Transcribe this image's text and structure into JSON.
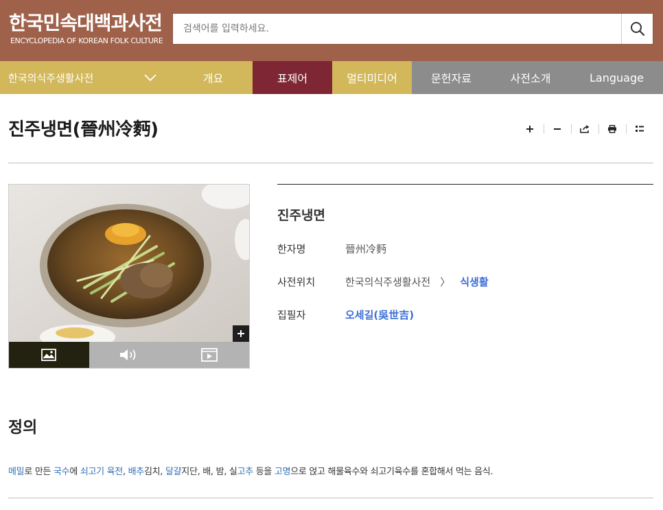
{
  "header": {
    "logo_ko": "한국민속대백과사전",
    "logo_en": "ENCYCLOPEDIA OF KOREAN FOLK CULTURE",
    "search_placeholder": "검색어를 입력하세요.",
    "search_icon": "search-icon"
  },
  "nav": {
    "dictionary": "한국의식주생활사전",
    "items": [
      "개요",
      "표제어",
      "멀티미디어",
      "문헌자료",
      "사전소개",
      "Language"
    ]
  },
  "entry": {
    "title": "진주냉면(晉州冷麪)",
    "name": "진주냉면",
    "rows": {
      "hanja_label": "한자명",
      "hanja_value": "晉州冷麪",
      "location_label": "사전위치",
      "location_dict": "한국의식주생활사전",
      "location_link": "식생활",
      "author_label": "집필자",
      "author_value": "오세길(吳世吉)"
    }
  },
  "media_tabs": [
    "image-icon",
    "audio-icon",
    "video-icon"
  ],
  "definition": {
    "heading": "정의",
    "segments": [
      {
        "text": "메밀",
        "link": true
      },
      {
        "text": "로 만든 ",
        "link": false
      },
      {
        "text": "국수",
        "link": true
      },
      {
        "text": "에 ",
        "link": false
      },
      {
        "text": "쇠고기 육전",
        "link": true
      },
      {
        "text": ", ",
        "link": false
      },
      {
        "text": "배추",
        "link": true
      },
      {
        "text": "김치, ",
        "link": false
      },
      {
        "text": "달걀",
        "link": true
      },
      {
        "text": "지단, 배, 밤, 실",
        "link": false
      },
      {
        "text": "고추",
        "link": true
      },
      {
        "text": " 등을 ",
        "link": false
      },
      {
        "text": "고명",
        "link": true
      },
      {
        "text": "으로 얹고 해물육수와 쇠고기육수를 혼합해서 먹는 음식.",
        "link": false
      }
    ]
  },
  "colors": {
    "header": "#a0614a",
    "nav_gold": "#d2b85a",
    "nav_active": "#7e2634",
    "nav_gray": "#8c8c8c",
    "link": "#3a6ed6"
  }
}
